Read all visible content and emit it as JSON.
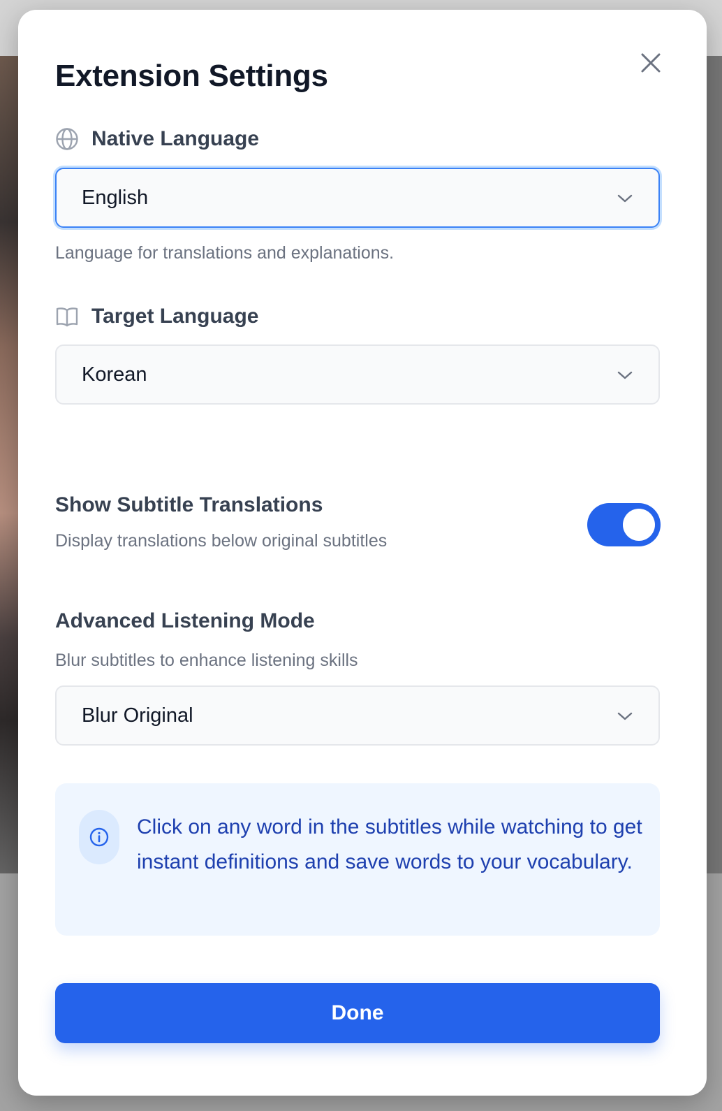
{
  "modal": {
    "title": "Extension Settings"
  },
  "native_language": {
    "label": "Native Language",
    "icon": "globe-icon",
    "value": "English",
    "help": "Language for translations and explanations."
  },
  "target_language": {
    "label": "Target Language",
    "icon": "book-icon",
    "value": "Korean"
  },
  "subtitle_translations": {
    "title": "Show Subtitle Translations",
    "description": "Display translations below original subtitles",
    "enabled": true
  },
  "listening_mode": {
    "title": "Advanced Listening Mode",
    "description": "Blur subtitles to enhance listening skills",
    "value": "Blur Original"
  },
  "info": {
    "icon": "info-icon",
    "text": "Click on any word in the subtitles while watching to get instant definitions and save words to your vocabulary."
  },
  "actions": {
    "done_label": "Done"
  },
  "colors": {
    "accent": "#2563eb",
    "info_bg": "#eff6ff",
    "info_text": "#1e40af"
  }
}
